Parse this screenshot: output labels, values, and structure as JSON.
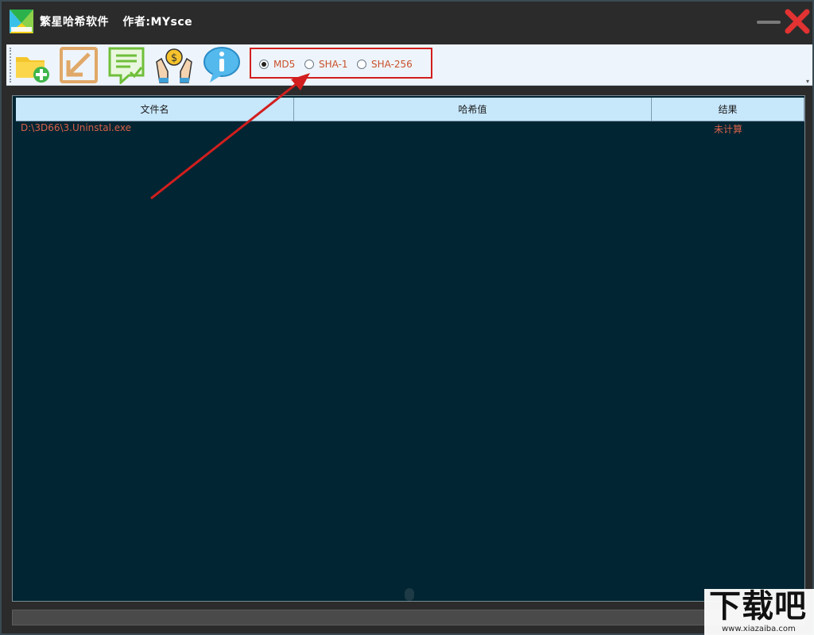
{
  "window": {
    "app_name": "繁星哈希软件",
    "author": "作者:MYsce"
  },
  "toolbar": {
    "tools": [
      {
        "name": "add-file"
      },
      {
        "name": "import"
      },
      {
        "name": "verify"
      },
      {
        "name": "donate"
      },
      {
        "name": "about"
      }
    ],
    "hash_options": [
      {
        "label": "MD5",
        "checked": true
      },
      {
        "label": "SHA-1",
        "checked": false
      },
      {
        "label": "SHA-256",
        "checked": false
      }
    ]
  },
  "table": {
    "columns": [
      "文件名",
      "哈希值",
      "结果"
    ],
    "rows": [
      {
        "file": "D:\\3D66\\3.Uninstal.exe",
        "hash": "",
        "result": "未计算"
      }
    ]
  },
  "colors": {
    "accent": "#d21e1e",
    "list_bg": "#012532",
    "header_bg": "#c7e7fb",
    "row_text": "#d8604a"
  },
  "watermark": {
    "big": "下载吧",
    "small": "www.xiazaiba.com"
  }
}
